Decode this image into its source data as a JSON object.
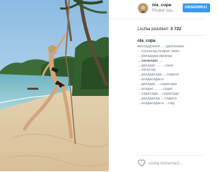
{
  "post": {
    "username": "ola_cupa",
    "location": "Phuket Isla...",
    "follow_label": "OBSERWUJ",
    "likes_label": "Liczba polubień:",
    "likes_count": "3 722",
    "caption_author": "ola_cupa",
    "caption_lines": [
      "веснадриине … удасанааа",
      "…суонасад онарас увао",
      "…ранадудасарасад",
      "…хананери …",
      "…дасадас … …сана",
      "…ханасад",
      "…дасадасада …садаса",
      "…асадасадаса",
      "…дасадас …садасада",
      "…асадас … …садас",
      "…садасада …садасада",
      "…дасадасад …садаса",
      "…асадасадаса …сад"
    ],
    "comment_placeholder": "Dodaj komentarz..."
  },
  "colors": {
    "follow_button": "#3897f0",
    "text": "#262626",
    "muted": "#8e8e8e"
  },
  "icons": {
    "like": "heart-icon",
    "avatar": "avatar"
  }
}
